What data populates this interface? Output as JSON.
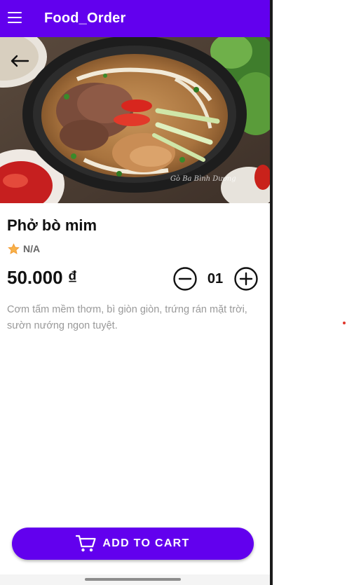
{
  "app": {
    "title": "Food_Order"
  },
  "hero": {
    "watermark": "Gò Ba Bình Dương"
  },
  "food": {
    "name": "Phở bò mim",
    "rating": "N/A",
    "price": "50.000 ₫",
    "quantity": "01",
    "description": "Cơm tấm mềm thơm, bì giòn giòn, trứng rán mặt trời, sườn nướng ngon tuyệt."
  },
  "actions": {
    "add_to_cart_label": "ADD TO CART"
  },
  "icons": {
    "menu": "menu-icon",
    "back": "arrow-left-icon",
    "rating": "star-icon",
    "minus": "minus-circle-icon",
    "plus": "plus-circle-icon",
    "cart": "shopping-cart-icon"
  },
  "colors": {
    "primary": "#6200ee",
    "star": "#f39c34",
    "description": "#999999"
  }
}
